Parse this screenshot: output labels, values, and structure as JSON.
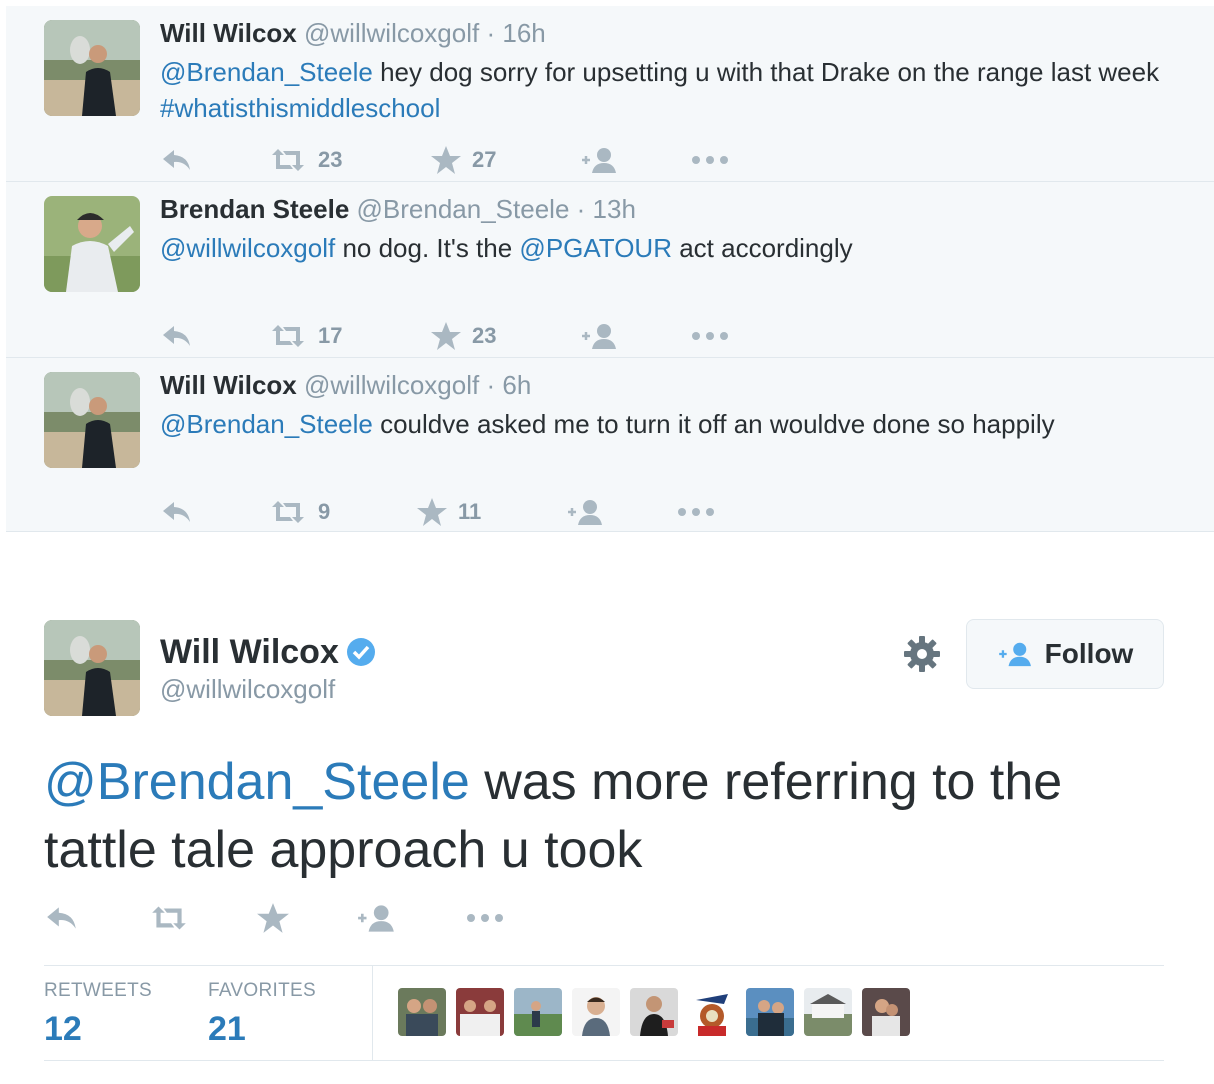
{
  "ancestors": [
    {
      "fullname": "Will Wilcox",
      "screenname": "@willwilcoxgolf",
      "separator": "·",
      "time": "16h",
      "text_parts": [
        {
          "text": "@Brendan_Steele",
          "link": true
        },
        {
          "text": " hey dog sorry for upsetting u with that Drake on the range last week ",
          "link": false
        },
        {
          "text": "#whatisthismiddleschool",
          "link": true
        }
      ],
      "retweets": "23",
      "favorites": "27"
    },
    {
      "fullname": "Brendan Steele",
      "screenname": "@Brendan_Steele",
      "separator": "·",
      "time": "13h",
      "text_parts": [
        {
          "text": "@willwilcoxgolf",
          "link": true
        },
        {
          "text": " no dog. It's the ",
          "link": false
        },
        {
          "text": "@PGATOUR",
          "link": true
        },
        {
          "text": " act accordingly",
          "link": false
        }
      ],
      "retweets": "17",
      "favorites": "23"
    },
    {
      "fullname": "Will Wilcox",
      "screenname": "@willwilcoxgolf",
      "separator": "·",
      "time": "6h",
      "text_parts": [
        {
          "text": "@Brendan_Steele",
          "link": true
        },
        {
          "text": " couldve asked me to turn it off an wouldve done so happily",
          "link": false
        }
      ],
      "retweets": "9",
      "favorites": "11"
    }
  ],
  "main": {
    "fullname": "Will Wilcox",
    "screenname": "@willwilcoxgolf",
    "follow_label": "Follow",
    "text_parts": [
      {
        "text": "@Brendan_Steele",
        "link": true
      },
      {
        "text": " was more referring to the tattle tale approach u took",
        "link": false
      }
    ],
    "stats": {
      "retweets_label": "RETWEETS",
      "retweets": "12",
      "favorites_label": "FAVORITES",
      "favorites": "21"
    },
    "favoriter_count": 9
  },
  "colors": {
    "link": "#2b7bb9",
    "muted": "#8899a6",
    "icon": "#aab8c2",
    "verified": "#55acee",
    "thread_bg": "#f5f8fa"
  },
  "icons": [
    "reply-icon",
    "retweet-icon",
    "favorite-icon",
    "follow-icon",
    "more-icon",
    "gear-icon",
    "verified-icon"
  ]
}
